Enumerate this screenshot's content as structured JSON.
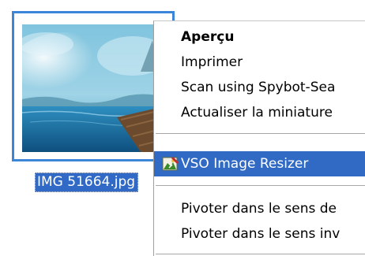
{
  "file": {
    "name": "IMG 51664.jpg"
  },
  "context_menu": {
    "items": [
      {
        "label": "Aperçu"
      },
      {
        "label": "Imprimer"
      },
      {
        "label": "Scan using Spybot-Sea"
      },
      {
        "label": "Actualiser la miniature"
      },
      {
        "label": "VSO Image Resizer",
        "icon": "vso-image-resizer-icon"
      },
      {
        "label": "Pivoter dans le sens de"
      },
      {
        "label": "Pivoter dans le sens inv"
      }
    ]
  },
  "colors": {
    "selection": "#316ac5",
    "thumbnail_border": "#3b86d8"
  }
}
